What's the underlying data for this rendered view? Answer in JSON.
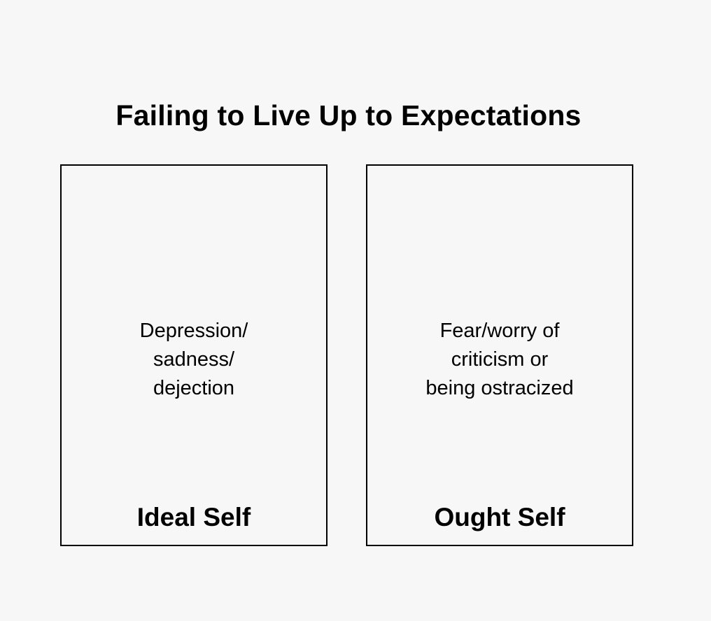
{
  "diagram": {
    "title": "Failing to Live Up to Expectations",
    "boxes": [
      {
        "description": "Depression/\nsadness/\ndejection",
        "label": "Ideal Self"
      },
      {
        "description": "Fear/worry of\ncriticism or\nbeing ostracized",
        "label": "Ought Self"
      }
    ]
  }
}
